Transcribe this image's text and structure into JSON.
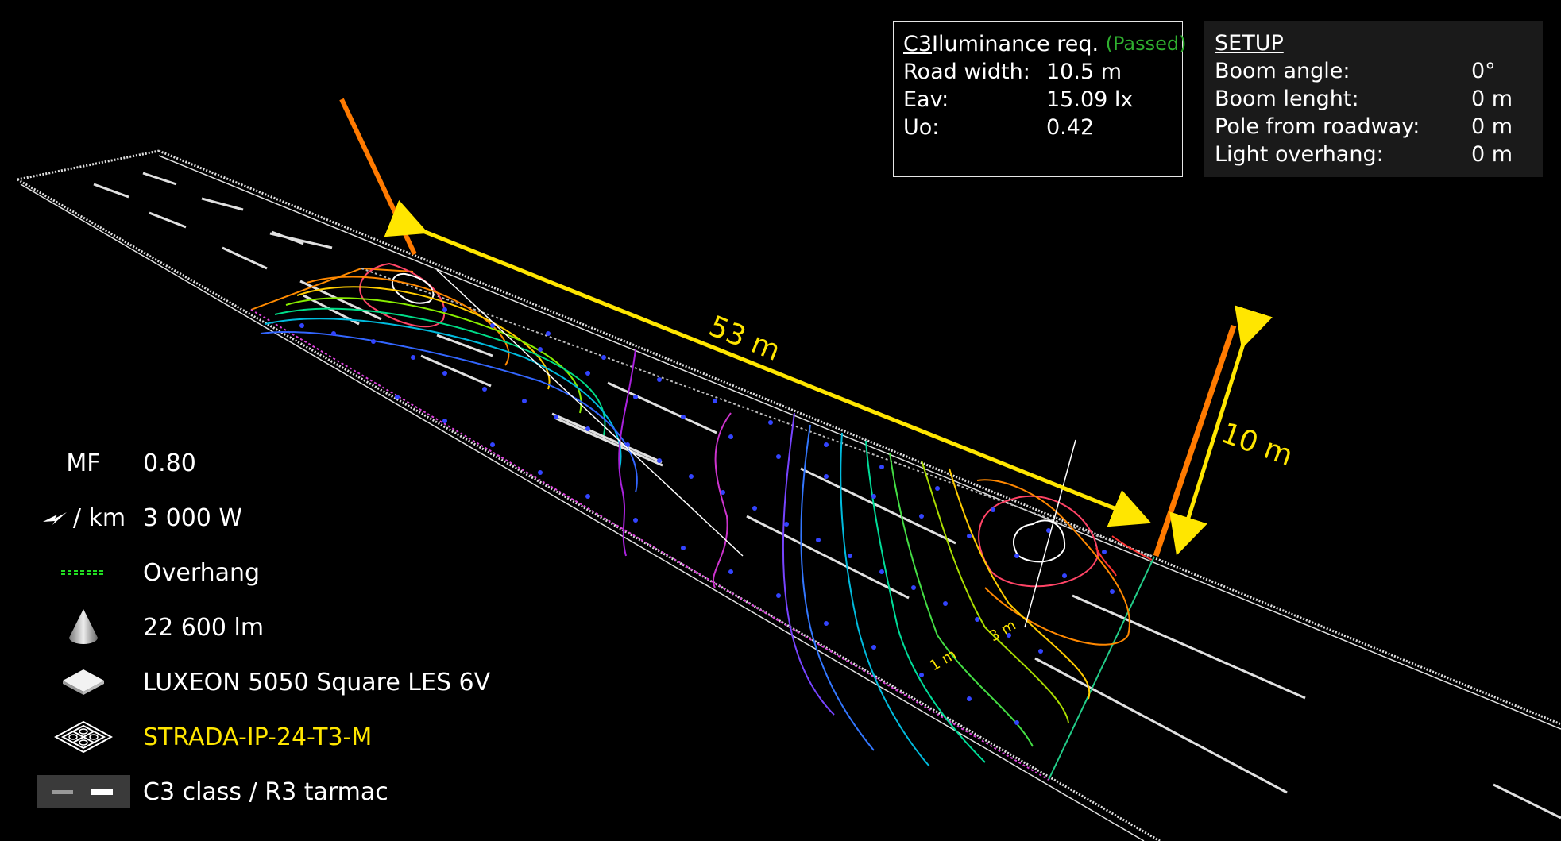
{
  "scene": {
    "spacing_label": "53 m",
    "height_label": "10 m",
    "contour_labels": [
      "1 m",
      "3 m"
    ]
  },
  "c3_panel": {
    "class_name": "C3",
    "title_rest": " Iluminance req.",
    "status": "(Passed)",
    "rows": [
      {
        "key": "Road width:",
        "value": "10.5 m"
      },
      {
        "key": "Eav:",
        "value": "15.09 lx"
      },
      {
        "key": "Uo:",
        "value": "0.42"
      }
    ]
  },
  "setup_panel": {
    "heading": "SETUP",
    "rows": [
      {
        "key": "Boom angle:",
        "value": "0°"
      },
      {
        "key": "Boom lenght:",
        "value": "0 m"
      },
      {
        "key": "Pole from roadway:",
        "value": "0 m"
      },
      {
        "key": "Light overhang:",
        "value": "0 m"
      }
    ]
  },
  "legend": {
    "mf_key": "MF",
    "mf_value": "0.80",
    "power_unit": "/ km",
    "power_value": "3 000 W",
    "overhang": "Overhang",
    "flux": "22 600 lm",
    "led": "LUXEON 5050 Square LES 6V",
    "luminaire": "STRADA-IP-24-T3-M",
    "road_class": "C3 class  / R3 tarmac"
  },
  "colors": {
    "pole": "#ff7a00",
    "dimension": "#ffe600",
    "status_passed": "#2fb02f",
    "calc_points": "#3344ff"
  }
}
